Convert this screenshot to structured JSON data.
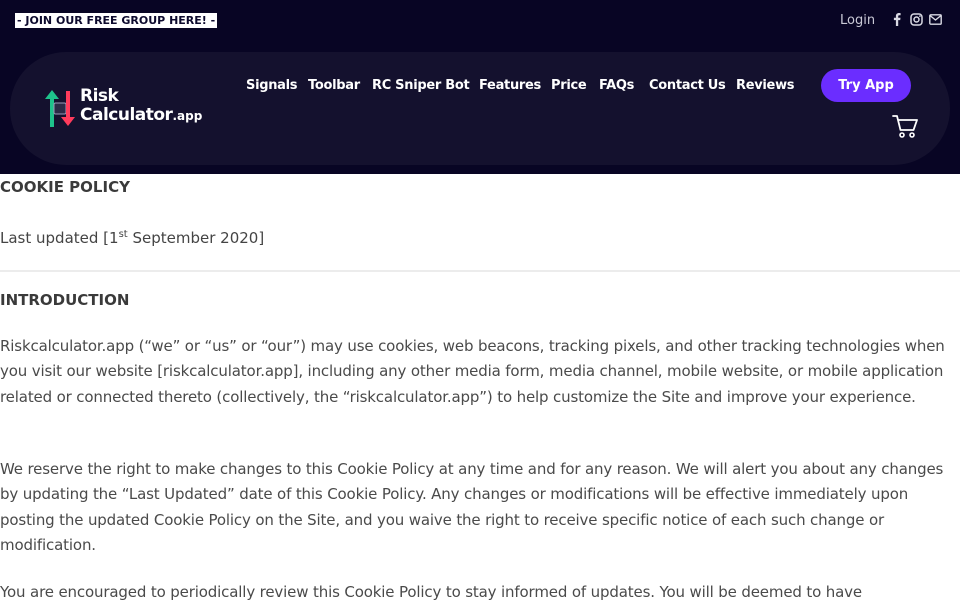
{
  "header": {
    "promo_label": "- JOIN OUR FREE GROUP HERE! -",
    "login_label": "Login",
    "social_icons": [
      "facebook-icon",
      "instagram-icon",
      "mail-icon"
    ]
  },
  "brand": {
    "line1": "Risk",
    "line2": "Calculator",
    "suffix": ".app",
    "arrow_up_color": "#1ec28b",
    "arrow_down_color": "#ff3b5c"
  },
  "nav": {
    "items": [
      "Signals",
      "Toolbar",
      "RC Sniper Bot",
      "Features",
      "Price",
      "FAQs",
      "Contact Us",
      "Reviews"
    ],
    "cta_label": "Try App",
    "cta_color": "#6b2dff"
  },
  "page": {
    "title": "COOKIE POLICY",
    "updated_prefix": "Last updated [1",
    "updated_sup": "st",
    "updated_suffix": " September 2020]",
    "intro_heading": "INTRODUCTION",
    "paragraphs": [
      "Riskcalculator.app (“we” or “us” or “our”) may use cookies, web beacons, tracking pixels, and other tracking technologies when you visit our website [riskcalculator.app], including any other media form, media channel, mobile website, or mobile application related or connected thereto (collectively, the “riskcalculator.app”) to help customize the Site and improve your experience.",
      "We reserve the right to make changes to this Cookie Policy at any time and for any reason. We will alert you about any changes by updating the “Last Updated” date of this Cookie Policy. Any changes or modifications will be effective immediately upon posting the updated Cookie Policy on the Site, and you waive the right to receive specific notice of each such change or modification.",
      "You are encouraged to periodically review this Cookie Policy to stay informed of updates. You will be deemed to have"
    ]
  }
}
